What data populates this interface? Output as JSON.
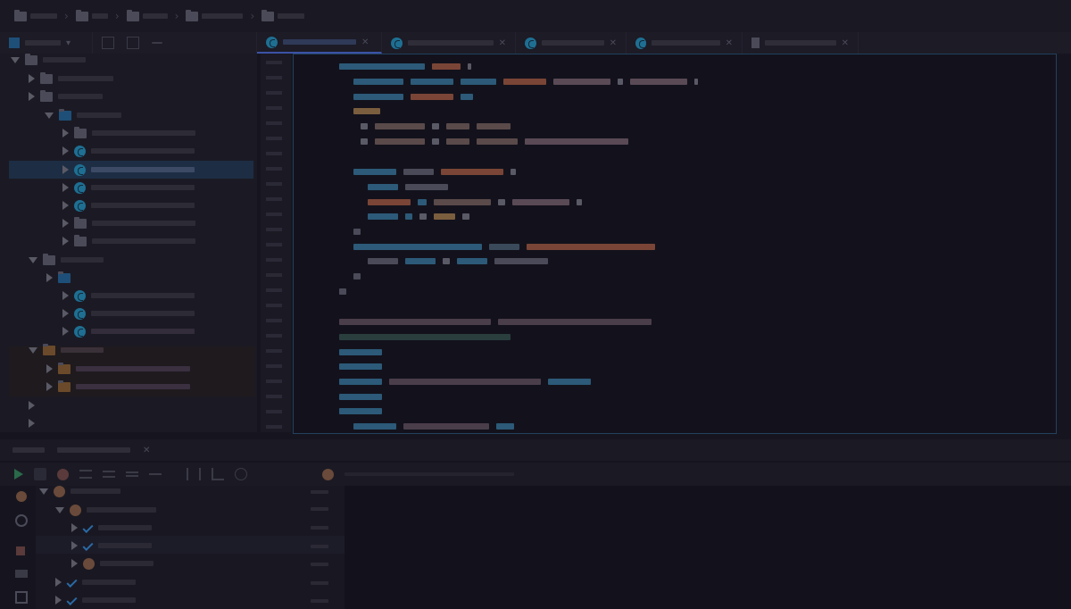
{
  "window": {
    "title": "",
    "theme": "dark",
    "colors": {
      "background": "#16151f",
      "panel": "#1b1a24",
      "editor": "#13121c",
      "keyword": "#2c5a78",
      "string": "#7a4536",
      "comment": "#4a4656",
      "selection": "#1d2e44",
      "accent": "#1e6f92"
    }
  },
  "breadcrumb": {
    "items": [
      {
        "icon": "folder-icon"
      },
      {
        "icon": "folder-icon"
      },
      {
        "icon": "folder-icon"
      },
      {
        "icon": "folder-icon"
      },
      {
        "icon": "folder-icon"
      }
    ]
  },
  "tabs": [
    {
      "icon": "class-icon",
      "active": false
    },
    {
      "icon": "class-icon",
      "active": true
    },
    {
      "icon": "class-icon",
      "active": false
    },
    {
      "icon": "class-icon",
      "active": false
    },
    {
      "icon": "class-icon",
      "active": false
    },
    {
      "icon": "file-icon",
      "active": false
    }
  ],
  "project_tree": {
    "selected_index": 6,
    "rows": [
      {
        "icon": "folder-icon",
        "expanded": true
      },
      {
        "icon": "folder-icon",
        "expanded": false
      },
      {
        "icon": "folder-icon",
        "expanded": false
      },
      {
        "icon": "package-icon",
        "expanded": true
      },
      {
        "icon": "folder-icon",
        "expanded": false
      },
      {
        "icon": "class-icon",
        "expanded": false
      },
      {
        "icon": "class-icon",
        "expanded": false
      },
      {
        "icon": "class-icon",
        "expanded": false
      },
      {
        "icon": "class-icon",
        "expanded": false
      },
      {
        "icon": "folder-icon",
        "expanded": false
      },
      {
        "icon": "folder-icon",
        "expanded": false
      },
      {
        "icon": "folder-icon",
        "expanded": true
      },
      {
        "icon": "package-icon",
        "expanded": false
      },
      {
        "icon": "class-icon",
        "expanded": false
      },
      {
        "icon": "class-icon",
        "expanded": false
      },
      {
        "icon": "class-icon",
        "expanded": false
      },
      {
        "icon": "folder-icon",
        "expanded": true
      },
      {
        "icon": "folder-icon",
        "expanded": false
      },
      {
        "icon": "folder-icon",
        "expanded": false
      }
    ]
  },
  "run_panel": {
    "toolbar_icons": [
      "run-icon",
      "check-icon",
      "stop-icon",
      "list-icon",
      "list-icon",
      "collapse-icon",
      "minus-icon",
      "separator-icon",
      "separator-icon",
      "branch-icon",
      "clock-icon"
    ],
    "tests": [
      {
        "status": "running"
      },
      {
        "status": "running"
      },
      {
        "status": "passed"
      },
      {
        "status": "passed"
      },
      {
        "status": "running"
      },
      {
        "status": "passed"
      },
      {
        "status": "passed"
      }
    ]
  }
}
